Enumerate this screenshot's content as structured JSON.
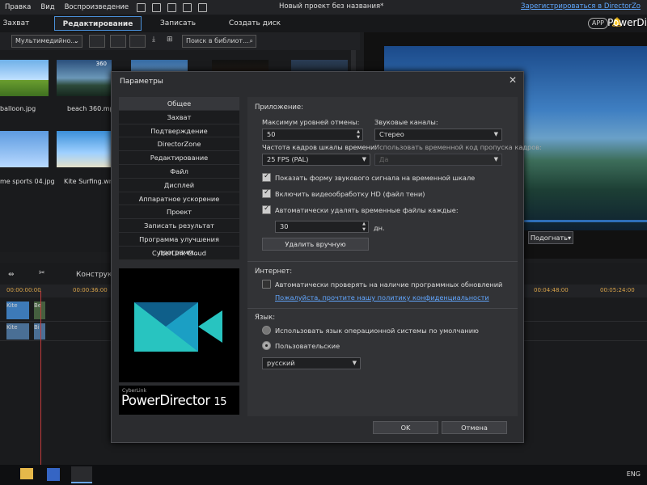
{
  "app": {
    "menu": [
      "Правка",
      "Вид",
      "Воспроизведение"
    ],
    "title": "Новый проект без названия*",
    "register_link": "Зарегистрироваться в DirectorZo",
    "tabs": [
      "Захват",
      "Редактирование",
      "Записать результат",
      "Создать диск"
    ],
    "active_tab": "Редактирование",
    "app_badge": "APP",
    "brand": "PowerDi"
  },
  "library": {
    "filter": "Мультимедийно...",
    "search_placeholder": "Поиск в библиот...",
    "items": [
      {
        "label": "balloon.jpg"
      },
      {
        "label": "beach 360.mp4",
        "badge": "360"
      },
      {
        "label": "me sports 04.jpg"
      },
      {
        "label": "Kite Surfing.wm"
      }
    ]
  },
  "preview": {
    "fit_label": "Подогнать▾"
  },
  "timeline": {
    "tool": "Конструкт",
    "times": [
      "00:00:00:00",
      "00:00:36:00",
      "00:04:48:00",
      "00:05:24:00"
    ],
    "clips": [
      "Kite",
      "Be",
      "Kite",
      "Bi"
    ]
  },
  "taskbar": {
    "lang": "ENG"
  },
  "dialog": {
    "title": "Параметры",
    "nav": [
      "Общее",
      "Захват",
      "Подтверждение",
      "DirectorZone",
      "Редактирование",
      "Файл",
      "Дисплей",
      "Аппаратное ускорение",
      "Проект",
      "Записать результат",
      "Программа улучшения программ...",
      "CyberLink Cloud"
    ],
    "active_nav": "Общее",
    "brand_small": "CyberLink",
    "brand_name": "PowerDirector",
    "brand_version": "15",
    "app_section": "Приложение:",
    "undo_label": "Максимум уровней отмены:",
    "undo_value": "50",
    "audio_label": "Звуковые каналы:",
    "audio_value": "Стерео",
    "fps_label": "Частота кадров шкалы времени:",
    "fps_value": "25 FPS (PAL)",
    "timecode_label": "Использовать временной код пропуска кадров:",
    "timecode_value": "Да",
    "checks": [
      {
        "label": "Показать форму звукового сигнала на временной шкале",
        "checked": true
      },
      {
        "label": "Включить видеообработку HD (файл тени)",
        "checked": true
      },
      {
        "label": "Автоматически удалять временные файлы каждые:",
        "checked": true
      }
    ],
    "days_value": "30",
    "days_unit": "дн.",
    "delete_btn": "Удалить вручную",
    "internet_section": "Интернет:",
    "update_label": "Автоматически проверять на наличие программных обновлений",
    "update_checked": false,
    "privacy_link": "Пожалуйста, прочтите нашу политику конфиденциальности",
    "lang_section": "Язык:",
    "lang_os": "Использовать язык операционной системы по умолчанию",
    "lang_custom": "Пользовательские",
    "lang_value": "русский",
    "ok": "OK",
    "cancel": "Отмена"
  }
}
